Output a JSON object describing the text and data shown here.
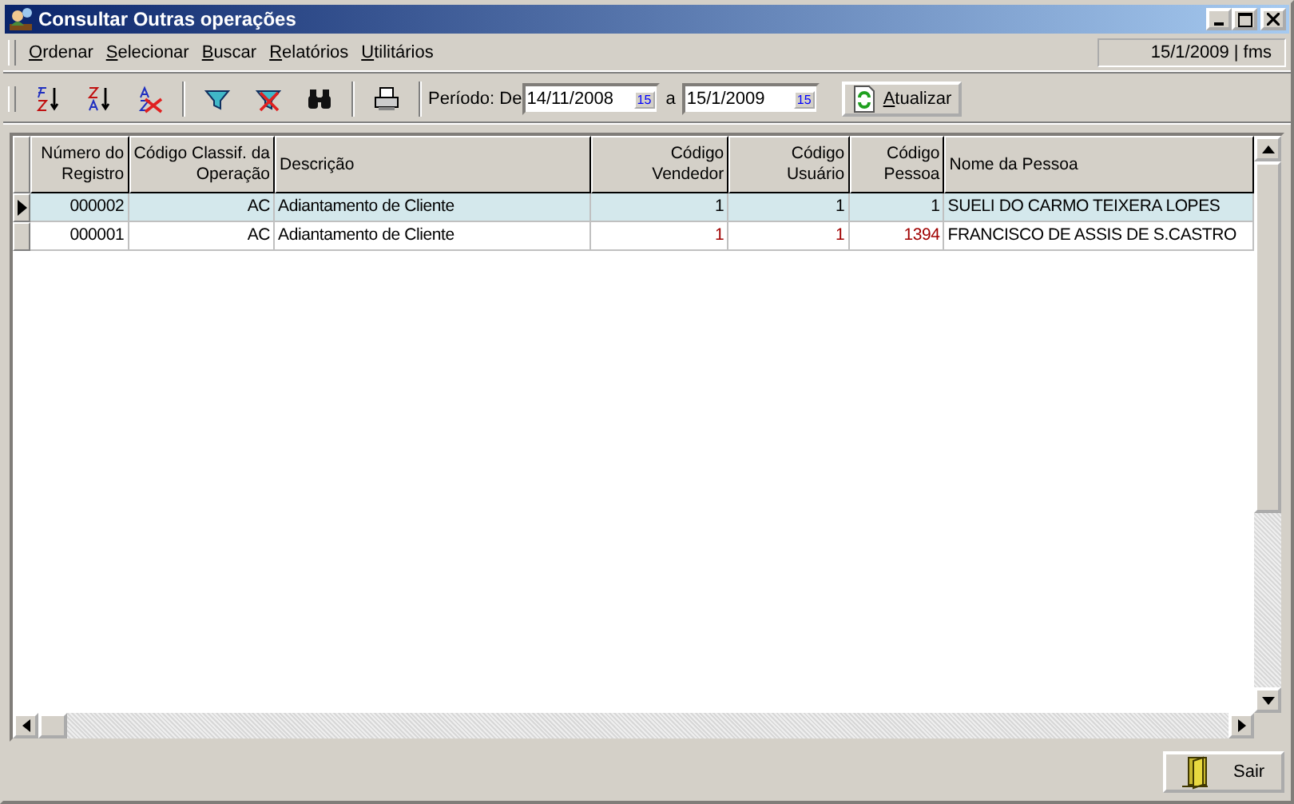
{
  "window": {
    "title": "Consultar Outras operações"
  },
  "menu": [
    {
      "label": "Ordenar"
    },
    {
      "label": "Selecionar"
    },
    {
      "label": "Buscar"
    },
    {
      "label": "Relatórios"
    },
    {
      "label": "Utilitários"
    }
  ],
  "status": "15/1/2009 | fms",
  "toolbar": {
    "period_label": "Período: De",
    "date_from": "14/11/2008",
    "date_sep": "a",
    "date_to": "15/1/2009",
    "calendar_from_label": "15",
    "calendar_to_label": "15",
    "refresh": "Atualizar"
  },
  "table": {
    "columns": [
      "Número do Registro",
      "Código Classif. da Operação",
      "Descrição",
      "Código Vendedor",
      "Código Usuário",
      "Código Pessoa",
      "Nome da Pessoa"
    ],
    "rows": [
      {
        "selected": true,
        "cells": [
          {
            "text": "000002",
            "warning": false
          },
          {
            "text": "AC",
            "warning": false
          },
          {
            "text": "Adiantamento de Cliente",
            "warning": false
          },
          {
            "text": "1",
            "warning": false
          },
          {
            "text": "1",
            "warning": false
          },
          {
            "text": "1",
            "warning": false
          },
          {
            "text": "SUELI DO CARMO TEIXERA LOPES",
            "warning": false
          }
        ]
      },
      {
        "selected": false,
        "cells": [
          {
            "text": "000001",
            "warning": false
          },
          {
            "text": "AC",
            "warning": false
          },
          {
            "text": "Adiantamento de Cliente",
            "warning": false
          },
          {
            "text": "1",
            "warning": true
          },
          {
            "text": "1",
            "warning": true
          },
          {
            "text": "1394",
            "warning": true
          },
          {
            "text": "FRANCISCO DE ASSIS DE S.CASTRO",
            "warning": false
          }
        ]
      }
    ]
  },
  "footer": {
    "exit": "Sair"
  }
}
